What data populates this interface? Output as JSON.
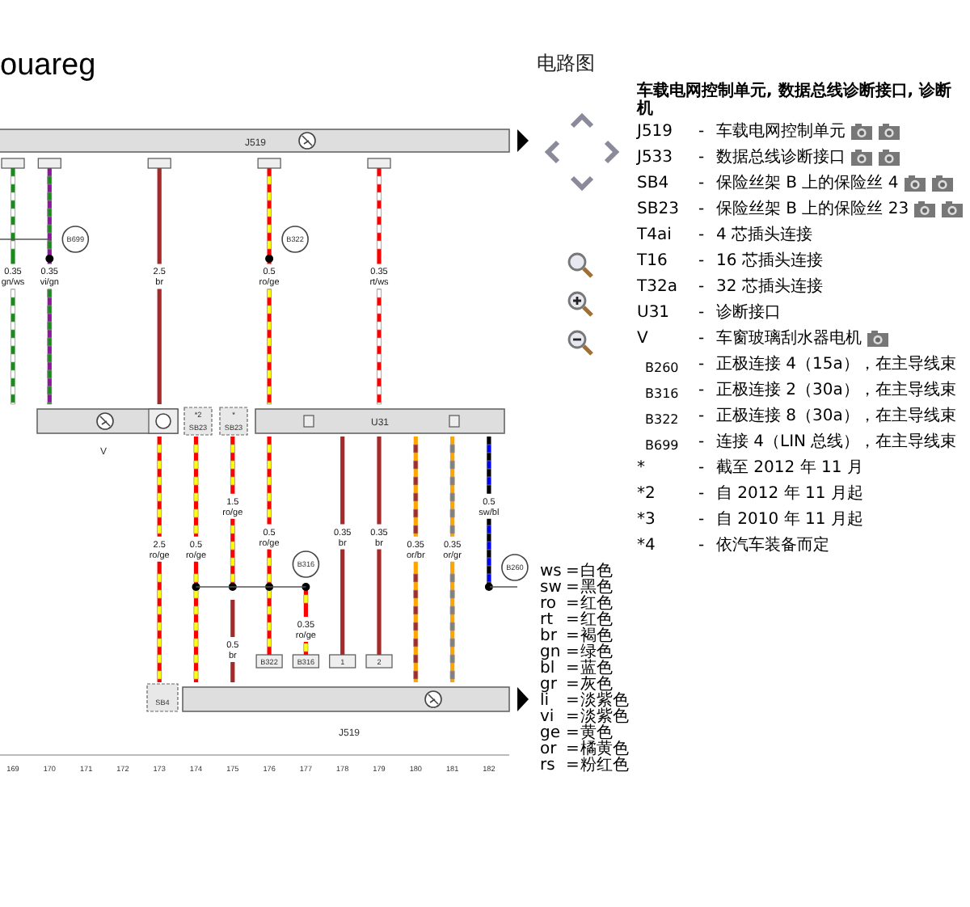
{
  "diagram": {
    "title": "ouareg",
    "top_bar": "J519",
    "bottom_bar": "J519",
    "control_unit": "U31",
    "motor": "V",
    "fuses": [
      {
        "note": "*2",
        "label": "SB23"
      },
      {
        "note": "*",
        "label": "SB23"
      }
    ],
    "fuse_bottom": "SB4",
    "columns": [
      {
        "number": "169",
        "upper_wires": [
          {
            "kind": "through",
            "color": "#1a8a1a",
            "stripe": {
              "color": "#ffffff"
            },
            "size": "0.35",
            "code": "gn/ws"
          }
        ]
      },
      {
        "number": "170",
        "upper_wires": [
          {
            "kind": "through",
            "color": "#8b1a9b",
            "stripe": {
              "color": "#1a8a1a"
            },
            "size": "0.35",
            "code": "vi/gn",
            "node": true,
            "splice": "B699"
          }
        ]
      },
      {
        "number": "171"
      },
      {
        "number": "172"
      },
      {
        "number": "173",
        "upper_wires": [
          {
            "kind": "through",
            "color": "#a52a2a",
            "size": "2.5",
            "code": "br"
          }
        ],
        "lower_wires": [
          {
            "kind": "through",
            "color": "#ff0000",
            "stripe": {
              "color": "#ffff00"
            },
            "size": "2.5",
            "code": "ro/ge"
          }
        ]
      },
      {
        "number": "174",
        "lower_wires": [
          {
            "kind": "through",
            "color": "#ff0000",
            "stripe": {
              "color": "#ffff00"
            },
            "size": "0.5",
            "code": "ro/ge",
            "node": true
          }
        ]
      },
      {
        "number": "175",
        "lower_wires": [
          {
            "kind": "to_splice",
            "color": "#ff0000",
            "stripe": {
              "color": "#ffff00"
            },
            "size": "1.5",
            "code": "ro/ge",
            "node": true
          },
          {
            "kind": "from_splice",
            "color": "#a52a2a",
            "size": "0.5",
            "code": "br"
          }
        ]
      },
      {
        "number": "176",
        "upper_wires": [
          {
            "kind": "through",
            "color": "#ff0000",
            "stripe": {
              "color": "#ffff00"
            },
            "size": "0.5",
            "code": "ro/ge",
            "node": true,
            "splice": "B322"
          }
        ],
        "lower_wires": [
          {
            "kind": "terminal",
            "color": "#ff0000",
            "stripe": {
              "color": "#ffff00"
            },
            "size": "0.5",
            "code": "ro/ge",
            "node": true,
            "terminal": "B322"
          }
        ]
      },
      {
        "number": "177",
        "lower_wires": [
          {
            "kind": "from_splice_terminal",
            "color": "#ff0000",
            "stripe": {
              "color": "#ffff00"
            },
            "size": "0.35",
            "code": "ro/ge",
            "node": true,
            "splice": "B316",
            "terminal": "B316"
          }
        ]
      },
      {
        "number": "178",
        "lower_wires": [
          {
            "kind": "terminal",
            "color": "#a52a2a",
            "size": "0.35",
            "code": "br",
            "terminal": "1"
          }
        ]
      },
      {
        "number": "179",
        "upper_wires": [
          {
            "kind": "through",
            "color": "#ff0000",
            "stripe": {
              "color": "#ffffff"
            },
            "size": "0.35",
            "code": "rt/ws"
          }
        ],
        "lower_wires": [
          {
            "kind": "terminal",
            "color": "#a52a2a",
            "size": "0.35",
            "code": "br",
            "terminal": "2"
          }
        ]
      },
      {
        "number": "180",
        "lower_wires": [
          {
            "kind": "through",
            "color": "#ffa500",
            "stripe": {
              "color": "#a52a2a"
            },
            "size": "0.35",
            "code": "or/br"
          }
        ]
      },
      {
        "number": "181",
        "lower_wires": [
          {
            "kind": "through",
            "color": "#ffa500",
            "stripe": {
              "color": "#808080"
            },
            "size": "0.35",
            "code": "or/gr"
          }
        ]
      },
      {
        "number": "182",
        "lower_wires": [
          {
            "kind": "to_splice",
            "color": "#000000",
            "stripe": {
              "color": "#0000ff"
            },
            "size": "0.5",
            "code": "sw/bl",
            "node": true,
            "splice": "B260"
          }
        ]
      }
    ]
  },
  "panel": {
    "title": "电路图",
    "heading": [
      "车载电网控制单元, 数据总线诊断接口, 诊断",
      "机"
    ],
    "legend": [
      {
        "kind": "part",
        "code": "J519",
        "text": "车载电网控制单元",
        "photos": [
          {
            "kind": "camera"
          },
          {
            "kind": "camera"
          }
        ]
      },
      {
        "kind": "part",
        "code": "J533",
        "text": "数据总线诊断接口",
        "photos": [
          {
            "kind": "camera"
          },
          {
            "kind": "camera"
          }
        ]
      },
      {
        "kind": "part",
        "code": "SB4",
        "text": "保险丝架 B 上的保险丝 4",
        "photos": [
          {
            "kind": "camera"
          },
          {
            "kind": "camera"
          }
        ]
      },
      {
        "kind": "part",
        "code": "SB23",
        "text": "保险丝架 B 上的保险丝 23",
        "photos": [
          {
            "kind": "camera"
          },
          {
            "kind": "camera"
          }
        ]
      },
      {
        "kind": "part",
        "code": "T4ai",
        "text": "4 芯插头连接"
      },
      {
        "kind": "part",
        "code": "T16",
        "text": "16 芯插头连接"
      },
      {
        "kind": "part",
        "code": "T32a",
        "text": "32 芯插头连接"
      },
      {
        "kind": "part",
        "code": "U31",
        "text": "诊断接口"
      },
      {
        "kind": "part",
        "code": "V",
        "text": "车窗玻璃刮水器电机",
        "photos": [
          {
            "kind": "camera"
          }
        ]
      },
      {
        "kind": "connection",
        "code": "B260",
        "text": "正极连接 4（15a），在主导线束"
      },
      {
        "kind": "connection",
        "code": "B316",
        "text": "正极连接 2（30a），在主导线束"
      },
      {
        "kind": "connection",
        "code": "B322",
        "text": "正极连接 8（30a），在主导线束"
      },
      {
        "kind": "connection",
        "code": "B699",
        "text": "连接 4（LIN 总线），在主导线束"
      },
      {
        "kind": "note",
        "code": "*",
        "text": "截至 2012 年 11 月"
      },
      {
        "kind": "note",
        "code": "*2",
        "text": "自 2012 年 11 月起"
      },
      {
        "kind": "note",
        "code": "*3",
        "text": "自 2010 年 11 月起"
      },
      {
        "kind": "note",
        "code": "*4",
        "text": "依汽车装备而定"
      }
    ],
    "dash": "-",
    "colors": [
      {
        "code": "ws",
        "name": "白色"
      },
      {
        "code": "sw",
        "name": "黑色"
      },
      {
        "code": "ro",
        "name": "红色"
      },
      {
        "code": "rt",
        "name": "红色"
      },
      {
        "code": "br",
        "name": "褐色"
      },
      {
        "code": "gn",
        "name": "绿色"
      },
      {
        "code": "bl",
        "name": "蓝色"
      },
      {
        "code": "gr",
        "name": "灰色"
      },
      {
        "code": "li",
        "name": "淡紫色"
      },
      {
        "code": "vi",
        "name": "淡紫色"
      },
      {
        "code": "ge",
        "name": "黄色"
      },
      {
        "code": "or",
        "name": "橘黄色"
      },
      {
        "code": "rs",
        "name": "粉红色"
      }
    ],
    "equals": "="
  }
}
